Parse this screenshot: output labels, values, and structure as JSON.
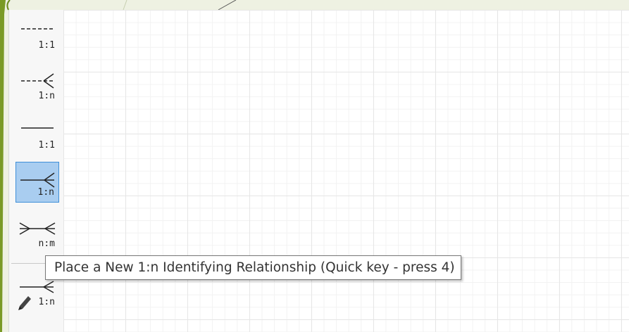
{
  "toolbar": {
    "tools": [
      {
        "label": "1:1",
        "icon": "dashed-one-to-one-icon",
        "selected": false
      },
      {
        "label": "1:n",
        "icon": "dashed-one-to-many-icon",
        "selected": false
      },
      {
        "label": "1:1",
        "icon": "solid-one-to-one-icon",
        "selected": false
      },
      {
        "label": "1:n",
        "icon": "solid-one-to-many-icon",
        "selected": true
      },
      {
        "label": "n:m",
        "icon": "many-to-many-icon",
        "selected": false
      },
      {
        "label": "1:n",
        "icon": "pencil-relationship-icon",
        "selected": false
      }
    ]
  },
  "tooltip": {
    "text": "Place a New 1:n Identifying Relationship (Quick key - press 4)"
  },
  "colors": {
    "selected_fill": "#a9cdf0",
    "selected_border": "#3f8fd8",
    "background": "#eef1e2"
  }
}
